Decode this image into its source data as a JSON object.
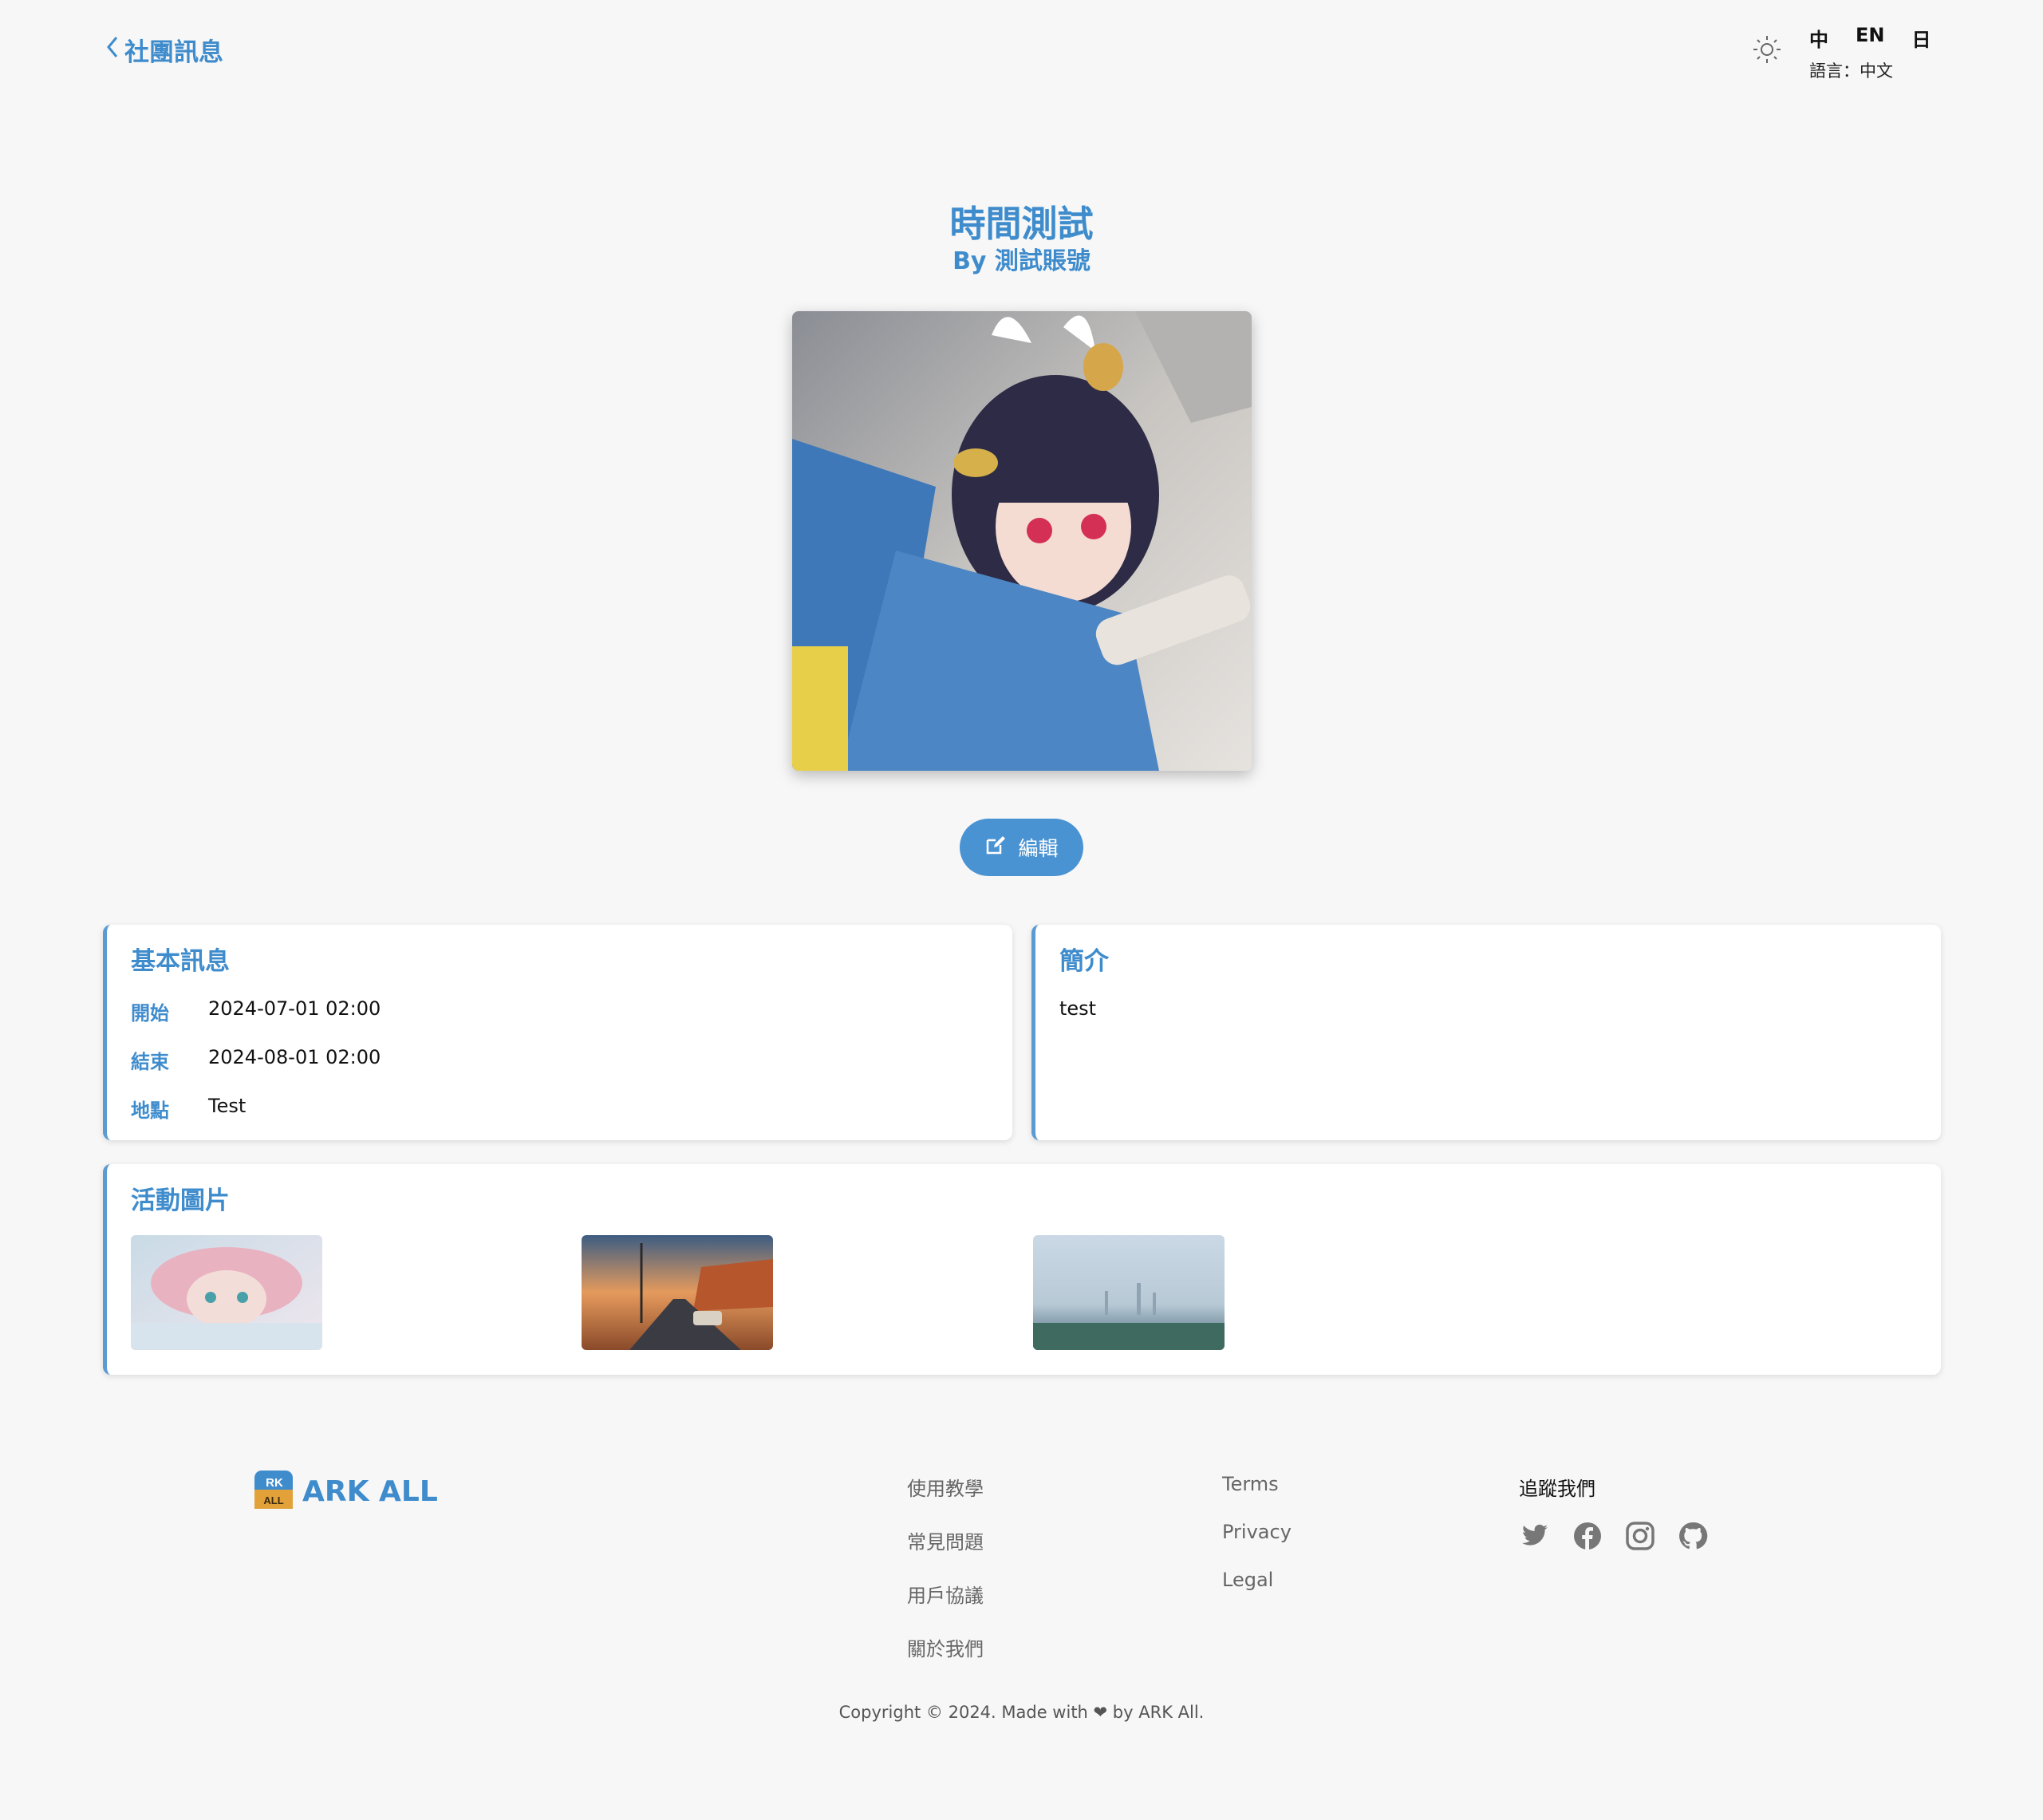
{
  "header": {
    "back_label": "社團訊息",
    "languages": [
      "中",
      "EN",
      "日"
    ],
    "current_language": "語言：中文"
  },
  "event": {
    "title": "時間測試",
    "author": "By 測試賬號",
    "edit_label": "編輯"
  },
  "basic_info": {
    "title": "基本訊息",
    "rows": [
      {
        "label": "開始",
        "value": "2024-07-01 02:00"
      },
      {
        "label": "結束",
        "value": "2024-08-01 02:00"
      },
      {
        "label": "地點",
        "value": "Test"
      }
    ]
  },
  "intro": {
    "title": "簡介",
    "text": "test"
  },
  "photos": {
    "title": "活動圖片"
  },
  "footer": {
    "logo_badge_top": "RK",
    "logo_badge_bottom": "ALL",
    "brand": "ARK ALL",
    "col1": [
      "使用教學",
      "常見問題",
      "用戶協議",
      "關於我們"
    ],
    "col2": [
      "Terms",
      "Privacy",
      "Legal"
    ],
    "follow_title": "追蹤我們",
    "copyright": "Copyright © 2024. Made with ❤ by ARK All."
  },
  "colors": {
    "accent": "#3f8ccd",
    "button": "#4a93d3",
    "background": "#f7f7f7"
  }
}
